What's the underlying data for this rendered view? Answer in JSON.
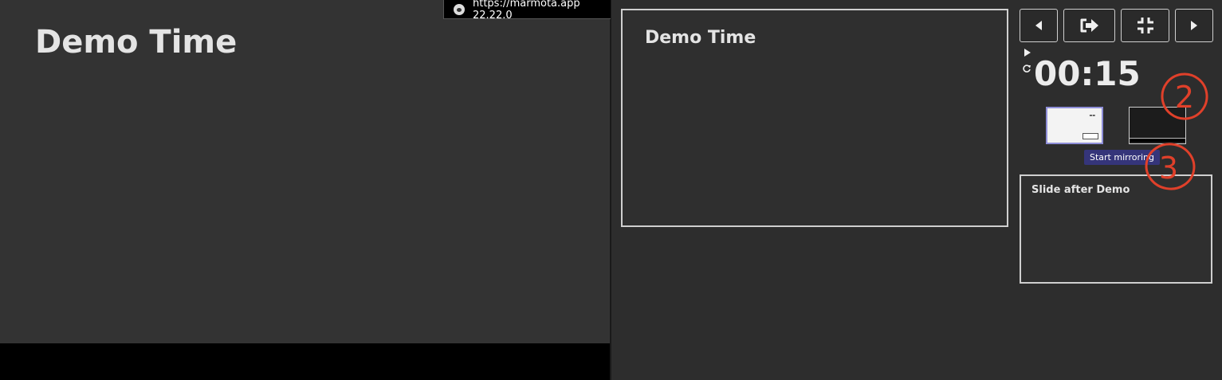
{
  "main_slide": {
    "title": "Demo Time"
  },
  "url_badge": {
    "logo_icon": "marmota-logo-icon",
    "text": "https://marmota.app 22.22.0"
  },
  "presenter": {
    "current_preview_title": "Demo Time",
    "toolbar": {
      "prev_icon": "triangle-left-icon",
      "exit_icon": "exit-icon",
      "compress_icon": "compress-icon",
      "next_icon": "triangle-right-icon"
    },
    "timer": {
      "value": "00:15",
      "play_icon": "play-icon",
      "reset_icon": "reset-icon"
    },
    "mirror_button": "Start mirroring",
    "next_preview_title": "Slide after Demo"
  },
  "annotations": {
    "mark_2": "2",
    "mark_3": "3",
    "color": "#e0402a"
  },
  "colors": {
    "accent": "#35357a",
    "thumb_border_active": "#8e8ed8",
    "background": "#2d2d2d"
  }
}
